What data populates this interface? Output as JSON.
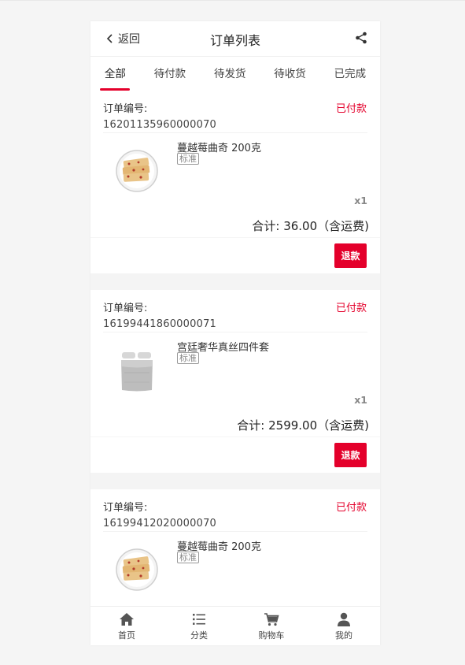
{
  "header": {
    "back_label": "返回",
    "title": "订单列表"
  },
  "tabs": [
    {
      "label": "全部"
    },
    {
      "label": "待付款"
    },
    {
      "label": "待发货"
    },
    {
      "label": "待收货"
    },
    {
      "label": "已完成"
    }
  ],
  "active_tab": "全部",
  "orders": [
    {
      "label": "订单编号:",
      "number": "16201135960000070",
      "status": "已付款",
      "product_name": "蔓越莓曲奇 200克",
      "spec": "标准",
      "qty": "x1",
      "total": "合计: 36.00（含运费)",
      "action": "退款",
      "image_icon": "cookie-image"
    },
    {
      "label": "订单编号:",
      "number": "16199441860000071",
      "status": "已付款",
      "product_name": "宫廷奢华真丝四件套",
      "spec": "标准",
      "qty": "x1",
      "total": "合计: 2599.00（含运费)",
      "action": "退款",
      "image_icon": "bedding-image"
    },
    {
      "label": "订单编号:",
      "number": "16199412020000070",
      "status": "已付款",
      "product_name": "蔓越莓曲奇 200克",
      "spec": "标准",
      "image_icon": "cookie-image"
    }
  ],
  "bottom_nav": [
    {
      "label": "首页",
      "icon": "home-icon"
    },
    {
      "label": "分类",
      "icon": "list-icon"
    },
    {
      "label": "购物车",
      "icon": "cart-icon"
    },
    {
      "label": "我的",
      "icon": "user-icon"
    }
  ],
  "colors": {
    "accent": "#e4002b",
    "page_bg": "#f5f5f5",
    "nav_icon": "#555555"
  }
}
